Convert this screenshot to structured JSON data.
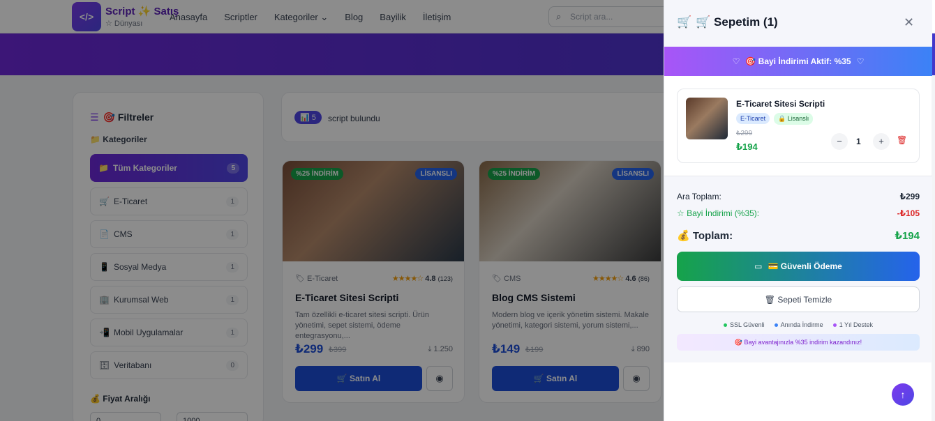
{
  "nav": {
    "logo_mark": "</>",
    "logo_title": "Script ✨ Satış",
    "logo_sub": "☆ Dünyası",
    "links": [
      "Anasayfa",
      "Scriptler",
      "Kategoriler ⌄",
      "Blog",
      "Bayilik",
      "İletişim"
    ],
    "search_placeholder": "Script ara..."
  },
  "filters": {
    "title": "🎯 Filtreler",
    "categories_label": "📁 Kategoriler",
    "categories": [
      {
        "icon": "📁",
        "label": "Tüm Kategoriler",
        "count": "5"
      },
      {
        "icon": "🛒",
        "label": "E-Ticaret",
        "count": "1"
      },
      {
        "icon": "📄",
        "label": "CMS",
        "count": "1"
      },
      {
        "icon": "📱",
        "label": "Sosyal Medya",
        "count": "1"
      },
      {
        "icon": "🏢",
        "label": "Kurumsal Web",
        "count": "1"
      },
      {
        "icon": "📲",
        "label": "Mobil Uygulamalar",
        "count": "1"
      },
      {
        "icon": "🗄",
        "label": "Veritabanı",
        "count": "0"
      }
    ],
    "price_label": "💰 Fiyat Aralığı",
    "price_min": "0",
    "price_max": "1000"
  },
  "results": {
    "badge": "📊 5",
    "text": "script bulundu"
  },
  "cards": [
    {
      "discount": "%25 İNDİRİM",
      "license": "LİSANSLI",
      "category": "E-Ticaret",
      "stars": "★★★★☆",
      "rating": "4.8",
      "reviews": "(123)",
      "title": "E-Ticaret Sitesi Scripti",
      "desc": "Tam özellikli e-ticaret sitesi scripti. Ürün yönetimi, sepet sistemi, ödeme entegrasyonu,...",
      "price": "₺299",
      "old_price": "₺399",
      "downloads": "1.250",
      "buy": "Satın Al"
    },
    {
      "discount": "%25 İNDİRİM",
      "license": "LİSANSLI",
      "category": "CMS",
      "stars": "★★★★☆",
      "rating": "4.6",
      "reviews": "(86)",
      "title": "Blog CMS Sistemi",
      "desc": "Modern blog ve içerik yönetim sistemi. Makale yönetimi, kategori sistemi, yorum sistemi,...",
      "price": "₺149",
      "old_price": "₺199",
      "downloads": "890",
      "buy": "Satın Al"
    }
  ],
  "cart": {
    "title": "🛒 Sepetim (1)",
    "banner": "🎯 Bayi İndirimi Aktif: %35",
    "item": {
      "title": "E-Ticaret Sitesi Scripti",
      "tag1": "E-Ticaret",
      "tag2": "🔒 Lisanslı",
      "old_price": "₺299",
      "price": "₺194",
      "qty": "1"
    },
    "subtotal_label": "Ara Toplam:",
    "subtotal": "₺299",
    "discount_label": "☆ Bayi İndirimi (%35):",
    "discount": "-₺105",
    "total_label": "💰 Toplam:",
    "total": "₺194",
    "pay_label": "💳 Güvenli Ödeme",
    "clear_label": "🗑 Sepeti Temizle",
    "features": [
      "SSL Güvenli",
      "Anında İndirme",
      "1 Yıl Destek"
    ],
    "feature_colors": [
      "#22c55e",
      "#3b82f6",
      "#a855f7"
    ],
    "note": "🎯 Bayi avantajınızla %35 indirim kazandınız!"
  }
}
